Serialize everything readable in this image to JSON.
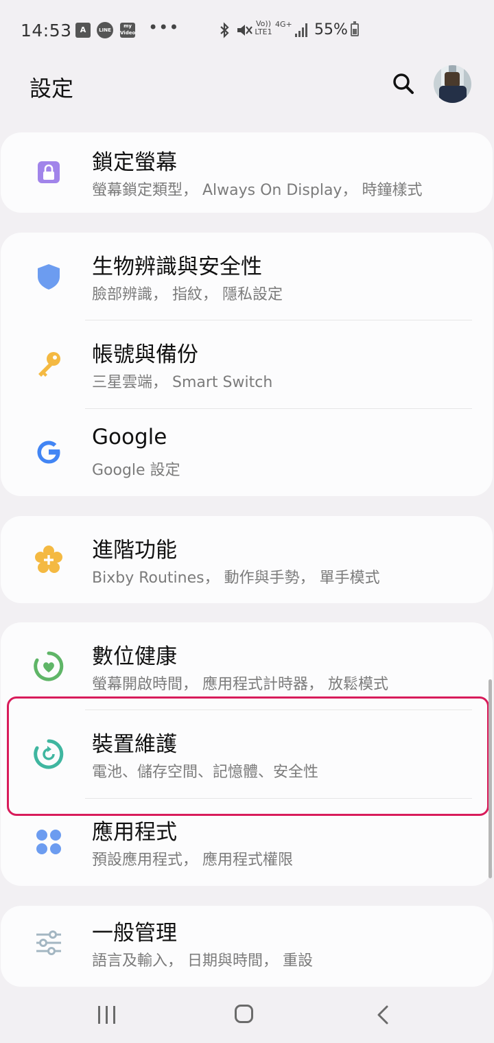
{
  "status_bar": {
    "time": "14:53",
    "notif_icons": [
      "A",
      "LINE",
      "my Video"
    ],
    "more": "•••",
    "volte": "Vo))",
    "lte": "LTE1",
    "network": "4G+",
    "battery": "55%"
  },
  "header": {
    "title": "設定"
  },
  "settings": [
    {
      "title": "鎖定螢幕",
      "subtitle": "螢幕鎖定類型， Always On Display， 時鐘樣式",
      "icon": "lock-icon",
      "color": "#9c7be3"
    },
    {
      "title": "生物辨識與安全性",
      "subtitle": "臉部辨識， 指紋， 隱私設定",
      "icon": "shield-icon",
      "color": "#5b8fe6"
    },
    {
      "title": "帳號與備份",
      "subtitle": "三星雲端， Smart Switch",
      "icon": "key-icon",
      "color": "#f4b942"
    },
    {
      "title": "Google",
      "subtitle": "Google 設定",
      "icon": "google-icon",
      "color": "#4285f4"
    },
    {
      "title": "進階功能",
      "subtitle": "Bixby Routines， 動作與手勢， 單手模式",
      "icon": "advanced-features-icon",
      "color": "#f4b942"
    },
    {
      "title": "數位健康",
      "subtitle": "螢幕開啟時間， 應用程式計時器， 放鬆模式",
      "icon": "digital-wellbeing-icon",
      "color": "#63b86a"
    },
    {
      "title": "裝置維護",
      "subtitle": "電池、儲存空間、記憶體、安全性",
      "icon": "device-care-icon",
      "color": "#3fb6a0"
    },
    {
      "title": "應用程式",
      "subtitle": "預設應用程式， 應用程式權限",
      "icon": "apps-icon",
      "color": "#5b8fe6"
    },
    {
      "title": "一般管理",
      "subtitle": "語言及輸入， 日期與時間， 重設",
      "icon": "sliders-icon",
      "color": "#8aa0b0"
    }
  ],
  "navbar": {
    "recent": "recent-apps-icon",
    "home": "home-icon",
    "back": "back-icon"
  }
}
